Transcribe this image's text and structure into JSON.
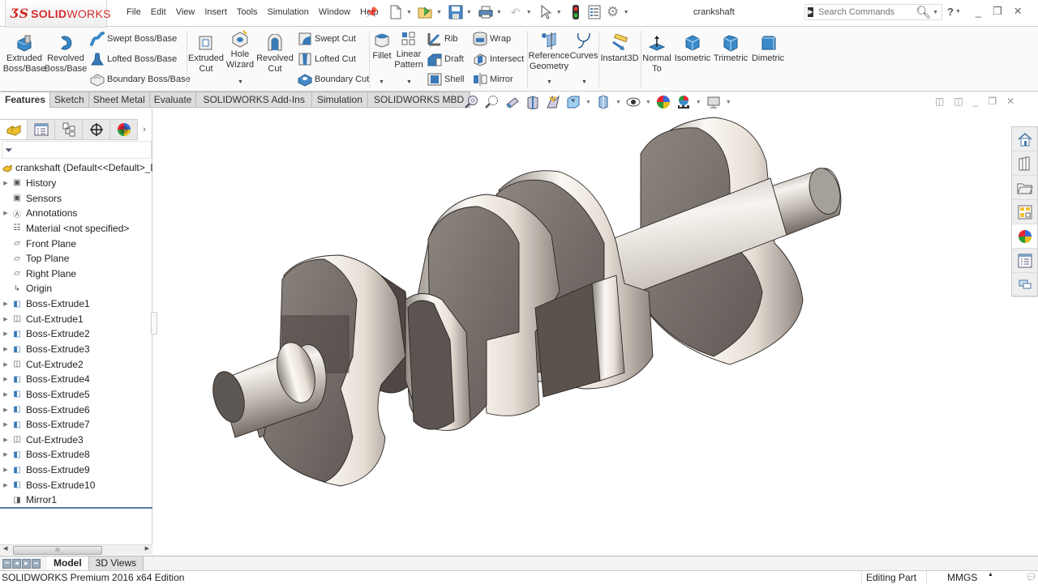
{
  "app": {
    "brand_ds": "ƷS",
    "brand_solid": "SOLID",
    "brand_works": "WORKS",
    "document_title": "crankshaft"
  },
  "menu": [
    "File",
    "Edit",
    "View",
    "Insert",
    "Tools",
    "Simulation",
    "Window",
    "Help"
  ],
  "quick_access": [
    {
      "icon": "new-document-icon",
      "glyph": "🗋"
    },
    {
      "icon": "open-icon",
      "glyph": "📂"
    },
    {
      "icon": "save-icon",
      "glyph": "💾"
    },
    {
      "icon": "print-icon",
      "glyph": "🖶"
    },
    {
      "icon": "undo-icon",
      "glyph": "↶"
    },
    {
      "icon": "select-icon",
      "glyph": "⇖"
    },
    {
      "icon": "rebuild-icon",
      "glyph": "▮"
    },
    {
      "icon": "file-properties-icon",
      "glyph": "☰"
    },
    {
      "icon": "options-icon",
      "glyph": "⚙"
    }
  ],
  "search": {
    "placeholder": "Search Commands"
  },
  "ribbon": {
    "extruded_boss": "Extruded\nBoss/Base",
    "revolved_boss": "Revolved\nBoss/Base",
    "swept_boss": "Swept Boss/Base",
    "lofted_boss": "Lofted Boss/Base",
    "boundary_boss": "Boundary Boss/Base",
    "extruded_cut": "Extruded\nCut",
    "hole_wizard": "Hole\nWizard",
    "revolved_cut": "Revolved\nCut",
    "swept_cut": "Swept Cut",
    "lofted_cut": "Lofted Cut",
    "boundary_cut": "Boundary Cut",
    "fillet": "Fillet",
    "linear_pattern": "Linear\nPattern",
    "rib": "Rib",
    "draft": "Draft",
    "shell": "Shell",
    "wrap": "Wrap",
    "intersect": "Intersect",
    "mirror": "Mirror",
    "reference_geometry": "Reference\nGeometry",
    "curves": "Curves",
    "instant3d": "Instant3D",
    "normal_to": "Normal\nTo",
    "isometric": "Isometric",
    "trimetric": "Trimetric",
    "dimetric": "Dimetric"
  },
  "tabs": [
    "Features",
    "Sketch",
    "Sheet Metal",
    "Evaluate",
    "SOLIDWORKS Add-Ins",
    "Simulation",
    "SOLIDWORKS MBD"
  ],
  "active_tab": "Features",
  "tree": {
    "root": "crankshaft  (Default<<Default>_D",
    "items": [
      {
        "label": "History",
        "icon": "history-folder-icon",
        "glyph": "▣",
        "expandable": true
      },
      {
        "label": "Sensors",
        "icon": "sensors-folder-icon",
        "glyph": "▣",
        "expandable": false
      },
      {
        "label": "Annotations",
        "icon": "annotations-folder-icon",
        "glyph": "Ⓐ",
        "expandable": true
      },
      {
        "label": "Material <not specified>",
        "icon": "material-icon",
        "glyph": "☷",
        "expandable": false
      },
      {
        "label": "Front Plane",
        "icon": "plane-icon",
        "glyph": "▱",
        "expandable": false
      },
      {
        "label": "Top Plane",
        "icon": "plane-icon",
        "glyph": "▱",
        "expandable": false
      },
      {
        "label": "Right Plane",
        "icon": "plane-icon",
        "glyph": "▱",
        "expandable": false
      },
      {
        "label": "Origin",
        "icon": "origin-icon",
        "glyph": "↳",
        "expandable": false
      },
      {
        "label": "Boss-Extrude1",
        "icon": "boss-extrude-icon",
        "glyph": "◧",
        "expandable": true
      },
      {
        "label": "Cut-Extrude1",
        "icon": "cut-extrude-icon",
        "glyph": "◫",
        "expandable": true
      },
      {
        "label": "Boss-Extrude2",
        "icon": "boss-extrude-icon",
        "glyph": "◧",
        "expandable": true
      },
      {
        "label": "Boss-Extrude3",
        "icon": "boss-extrude-icon",
        "glyph": "◧",
        "expandable": true
      },
      {
        "label": "Cut-Extrude2",
        "icon": "cut-extrude-icon",
        "glyph": "◫",
        "expandable": true
      },
      {
        "label": "Boss-Extrude4",
        "icon": "boss-extrude-icon",
        "glyph": "◧",
        "expandable": true
      },
      {
        "label": "Boss-Extrude5",
        "icon": "boss-extrude-icon",
        "glyph": "◧",
        "expandable": true
      },
      {
        "label": "Boss-Extrude6",
        "icon": "boss-extrude-icon",
        "glyph": "◧",
        "expandable": true
      },
      {
        "label": "Boss-Extrude7",
        "icon": "boss-extrude-icon",
        "glyph": "◧",
        "expandable": true
      },
      {
        "label": "Cut-Extrude3",
        "icon": "cut-extrude-icon",
        "glyph": "◫",
        "expandable": true
      },
      {
        "label": "Boss-Extrude8",
        "icon": "boss-extrude-icon",
        "glyph": "◧",
        "expandable": true
      },
      {
        "label": "Boss-Extrude9",
        "icon": "boss-extrude-icon",
        "glyph": "◧",
        "expandable": true
      },
      {
        "label": "Boss-Extrude10",
        "icon": "boss-extrude-icon",
        "glyph": "◧",
        "expandable": true
      },
      {
        "label": "Mirror1",
        "icon": "mirror-feature-icon",
        "glyph": "◨",
        "expandable": false
      }
    ]
  },
  "bottom_tabs": [
    "Model",
    "3D Views"
  ],
  "status": {
    "edition": "SOLIDWORKS Premium 2016 x64 Edition",
    "mode": "Editing Part",
    "units": "MMGS"
  },
  "colors": {
    "brand_red": "#d42a2a",
    "model_face": "#6e6660",
    "model_highlight": "#f4efe8",
    "model_dark": "#4a423d"
  }
}
